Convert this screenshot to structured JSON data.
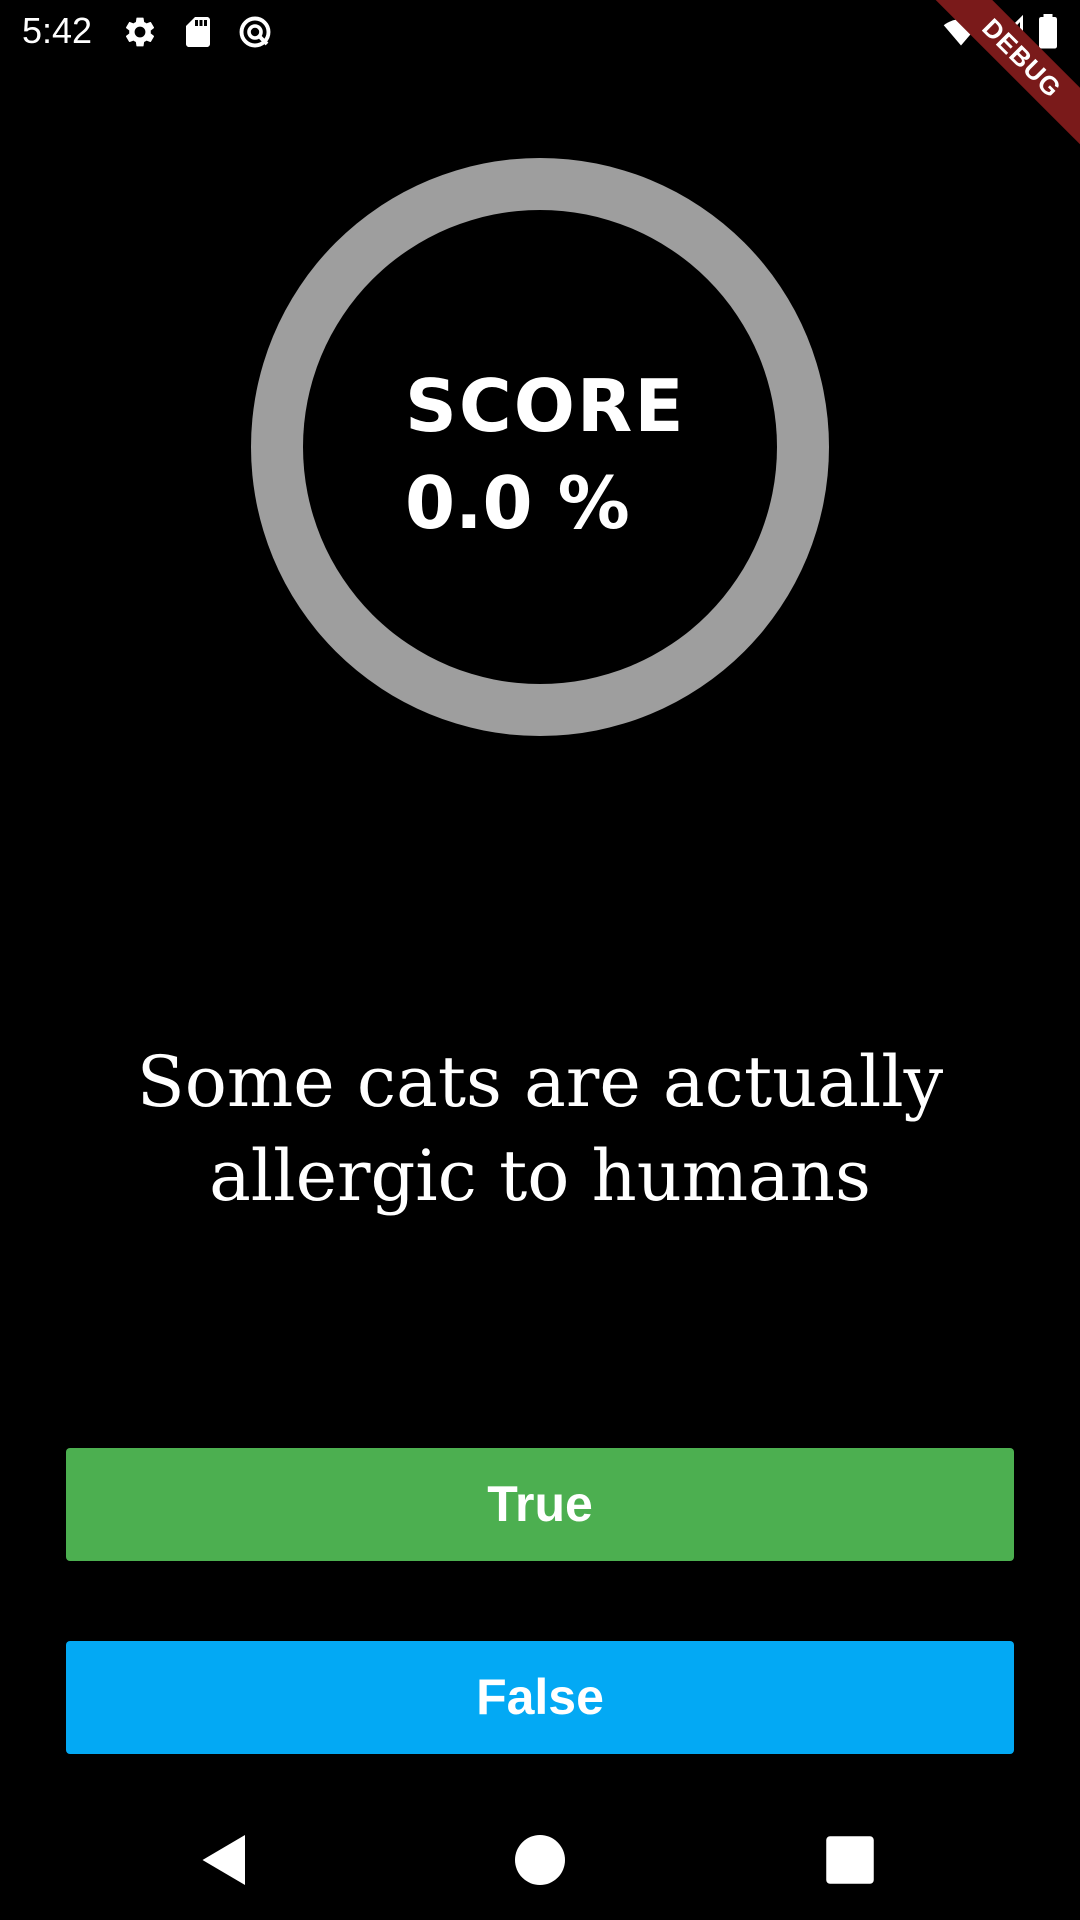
{
  "status_bar": {
    "time": "5:42",
    "icons_left": [
      "gear-icon",
      "sd-card-icon",
      "data-saver-icon"
    ],
    "icons_right": [
      "wifi-icon",
      "cell-signal-icon",
      "battery-icon"
    ],
    "debug_label": "DEBUG"
  },
  "score": {
    "label": "SCORE",
    "value": "0.0 %",
    "ring_color": "#9e9e9e"
  },
  "question": {
    "text": "Some cats are actually allergic to humans"
  },
  "buttons": {
    "true_label": "True",
    "false_label": "False",
    "true_color": "#4caf50",
    "false_color": "#03a9f4"
  },
  "nav": {
    "icons": [
      "back-icon",
      "home-icon",
      "recents-icon"
    ]
  }
}
